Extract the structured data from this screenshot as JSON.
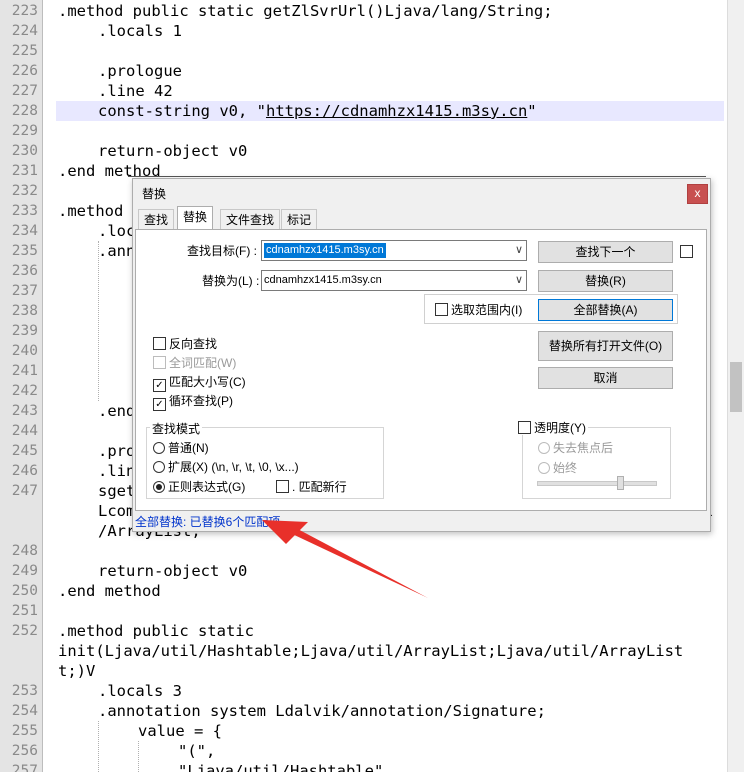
{
  "editor": {
    "lines": [
      {
        "n": "223",
        "text": ".method public static getZlSvrUrl()Ljava/lang/String;",
        "indent": 0
      },
      {
        "n": "224",
        "text": ".locals 1",
        "indent": 1
      },
      {
        "n": "225",
        "text": "",
        "indent": 0
      },
      {
        "n": "226",
        "text": ".prologue",
        "indent": 1
      },
      {
        "n": "227",
        "text": ".line 42",
        "indent": 1
      },
      {
        "n": "228",
        "text": "const-string v0, \"",
        "url": "https://cdnamhzx1415.m3sy.cn",
        "after": "\"",
        "indent": 1
      },
      {
        "n": "229",
        "text": "",
        "indent": 0
      },
      {
        "n": "230",
        "text": "return-object v0",
        "indent": 1
      },
      {
        "n": "231",
        "text": ".end method",
        "indent": 0
      },
      {
        "n": "232",
        "text": "",
        "indent": 0
      },
      {
        "n": "233",
        "text": ".method",
        "indent": 0
      },
      {
        "n": "234",
        "text": ".loc",
        "indent": 1
      },
      {
        "n": "235",
        "text": ".ann",
        "indent": 1
      },
      {
        "n": "236",
        "text": "",
        "indent": 0
      },
      {
        "n": "237",
        "text": "",
        "indent": 0
      },
      {
        "n": "238",
        "text": "",
        "indent": 0
      },
      {
        "n": "239",
        "text": "",
        "indent": 0
      },
      {
        "n": "240",
        "text": "",
        "indent": 0
      },
      {
        "n": "241",
        "text": "",
        "indent": 0
      },
      {
        "n": "242",
        "text": "",
        "indent": 0
      },
      {
        "n": "243",
        "text": ".end",
        "indent": 1
      },
      {
        "n": "244",
        "text": "",
        "indent": 0
      },
      {
        "n": "245",
        "text": ".pro",
        "indent": 1
      },
      {
        "n": "246",
        "text": ".lin",
        "indent": 1
      },
      {
        "n": "247",
        "text": "sget",
        "indent": 1
      },
      {
        "n": "",
        "text": "Lcom",
        "indent": 1
      },
      {
        "n": "",
        "text": "/ArrayList;",
        "indent": 1
      },
      {
        "n": "248",
        "text": "",
        "indent": 0
      },
      {
        "n": "249",
        "text": "return-object v0",
        "indent": 1
      },
      {
        "n": "250",
        "text": ".end method",
        "indent": 0
      },
      {
        "n": "251",
        "text": "",
        "indent": 0
      },
      {
        "n": "252",
        "text": ".method public static",
        "indent": 0
      },
      {
        "n": "",
        "text": "init(Ljava/util/Hashtable;Ljava/util/ArrayList;Ljava/util/ArrayList",
        "indent": 0
      },
      {
        "n": "",
        "text": "t;)V",
        "indent": 0
      },
      {
        "n": "253",
        "text": ".locals 3",
        "indent": 1
      },
      {
        "n": "254",
        "text": ".annotation system Ldalvik/annotation/Signature;",
        "indent": 1
      },
      {
        "n": "255",
        "text": "value = {",
        "indent": 2
      },
      {
        "n": "256",
        "text": "\"(\",",
        "indent": 3
      },
      {
        "n": "257",
        "text": "\"Ljava/util/Hashtable\"",
        "indent": 3
      }
    ],
    "overflow_char": "l"
  },
  "dialog": {
    "title": "替换",
    "close": "x",
    "tabs": [
      "查找",
      "替换",
      "文件查找",
      "标记"
    ],
    "find_label": "查找目标(F) :",
    "find_value": "cdnamhzx1415.m3sy.cn",
    "replace_label": "替换为(L) :",
    "replace_value": "cdnamhzx1415.m3sy.cn",
    "btn_find_next": "查找下一个",
    "btn_replace": "替换(R)",
    "btn_replace_all": "全部替换(A)",
    "btn_replace_all_open": "替换所有打开文件(O)",
    "btn_cancel": "取消",
    "in_selection": "选取范围内(I)",
    "backward": "反向查找",
    "whole_word": "全词匹配(W)",
    "match_case": "匹配大小写(C)",
    "wrap": "循环查找(P)",
    "search_mode_title": "查找模式",
    "mode_normal": "普通(N)",
    "mode_extended": "扩展(X) (\\n, \\r, \\t, \\0, \\x...)",
    "mode_regex": "正则表达式(G)",
    "dot_newline": ". 匹配新行",
    "transparency": "透明度(Y)",
    "on_lose_focus": "失去焦点后",
    "always": "始终",
    "status": "全部替换: 已替换6个匹配项。"
  },
  "colors": {
    "accent": "#0078d7",
    "arrow": "#e8302a",
    "status": "#0033cc"
  }
}
